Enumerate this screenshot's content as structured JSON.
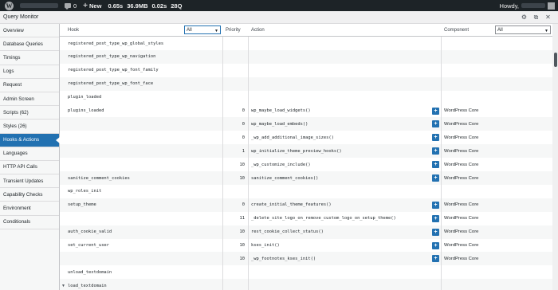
{
  "adminbar": {
    "new_label": "New",
    "comment_count": "0",
    "stats": [
      "0.65s",
      "36.9MB",
      "0.02s",
      "28Q"
    ],
    "howdy_label": "Howdy,"
  },
  "panel": {
    "title": "Query Monitor"
  },
  "sidebar": {
    "items": [
      {
        "label": "Overview"
      },
      {
        "label": "Database Queries"
      },
      {
        "label": "Timings"
      },
      {
        "label": "Logs"
      },
      {
        "label": "Request"
      },
      {
        "label": "Admin Screen"
      },
      {
        "label": "Scripts (62)"
      },
      {
        "label": "Styles (26)"
      },
      {
        "label": "Hooks & Actions",
        "active": true
      },
      {
        "label": "Languages"
      },
      {
        "label": "HTTP API Calls"
      },
      {
        "label": "Transient Updates"
      },
      {
        "label": "Capability Checks"
      },
      {
        "label": "Environment"
      },
      {
        "label": "Conditionals"
      }
    ]
  },
  "table": {
    "headers": {
      "hook": "Hook",
      "priority": "Priority",
      "action": "Action",
      "component": "Component"
    },
    "hook_filter": "All",
    "component_filter": "All",
    "rows": [
      {
        "hook": "registered_post_type_wp_global_styles",
        "priority": "",
        "action": "",
        "component": ""
      },
      {
        "hook": "registered_post_type_wp_navigation",
        "priority": "",
        "action": "",
        "component": ""
      },
      {
        "hook": "registered_post_type_wp_font_family",
        "priority": "",
        "action": "",
        "component": ""
      },
      {
        "hook": "registered_post_type_wp_font_face",
        "priority": "",
        "action": "",
        "component": ""
      },
      {
        "hook": "plugin_loaded",
        "priority": "",
        "action": "",
        "component": ""
      },
      {
        "hook": "plugins_loaded",
        "priority": "0",
        "action": "wp_maybe_load_widgets()",
        "component": "WordPress Core"
      },
      {
        "hook": "",
        "priority": "0",
        "action": "wp_maybe_load_embeds()",
        "component": "WordPress Core"
      },
      {
        "hook": "",
        "priority": "0",
        "action": "_wp_add_additional_image_sizes()",
        "component": "WordPress Core"
      },
      {
        "hook": "",
        "priority": "1",
        "action": "wp_initialize_theme_preview_hooks()",
        "component": "WordPress Core"
      },
      {
        "hook": "",
        "priority": "10",
        "action": "_wp_customize_include()",
        "component": "WordPress Core"
      },
      {
        "hook": "sanitize_comment_cookies",
        "priority": "10",
        "action": "sanitize_comment_cookies()",
        "component": "WordPress Core"
      },
      {
        "hook": "wp_roles_init",
        "priority": "",
        "action": "",
        "component": ""
      },
      {
        "hook": "setup_theme",
        "priority": "0",
        "action": "create_initial_theme_features()",
        "component": "WordPress Core"
      },
      {
        "hook": "",
        "priority": "11",
        "action": "_delete_site_logo_on_remove_custom_logo_on_setup_theme()",
        "component": "WordPress Core"
      },
      {
        "hook": "auth_cookie_valid",
        "priority": "10",
        "action": "rest_cookie_collect_status()",
        "component": "WordPress Core"
      },
      {
        "hook": "set_current_user",
        "priority": "10",
        "action": "kses_init()",
        "component": "WordPress Core"
      },
      {
        "hook": "",
        "priority": "10",
        "action": "_wp_footnotes_kses_init()",
        "component": "WordPress Core"
      },
      {
        "hook": "unload_textdomain",
        "priority": "",
        "action": "",
        "component": ""
      },
      {
        "hook": "load_textdomain",
        "priority": "",
        "action": "",
        "component": ""
      }
    ]
  }
}
